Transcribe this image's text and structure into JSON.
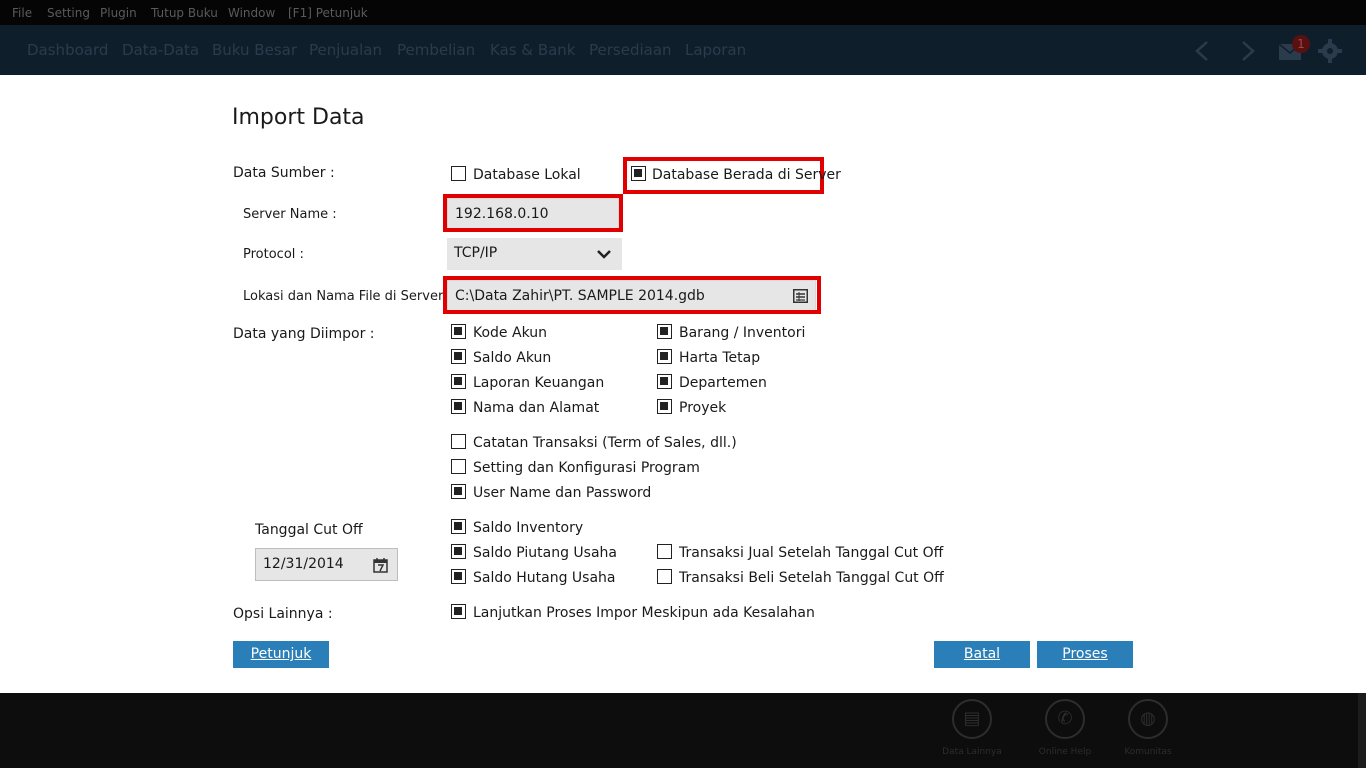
{
  "menubar": {
    "items": [
      "File",
      "Setting",
      "Plugin",
      "Tutup Buku",
      "Window",
      "[F1] Petunjuk"
    ]
  },
  "navbar": {
    "items": [
      "Dashboard",
      "Data-Data",
      "Buku Besar",
      "Penjualan",
      "Pembelian",
      "Kas & Bank",
      "Persediaan",
      "Laporan"
    ],
    "notification_count": "1"
  },
  "dialog": {
    "title": "Import Data",
    "data_sumber_label": "Data Sumber  :",
    "database_lokal": {
      "label": "Database Lokal",
      "checked": false
    },
    "database_server": {
      "label": "Database Berada di Server",
      "checked": true
    },
    "server_name_label": "Server Name :",
    "server_name_value": "192.168.0.10",
    "protocol_label": "Protocol :",
    "protocol_value": "TCP/IP",
    "lokasi_label": "Lokasi dan Nama File di Server :",
    "lokasi_value": "C:\\Data Zahir\\PT. SAMPLE 2014.gdb",
    "data_diimpor_label": "Data yang Diimpor :",
    "import_items": [
      {
        "label": "Kode Akun",
        "checked": true
      },
      {
        "label": "Saldo Akun",
        "checked": true
      },
      {
        "label": "Laporan Keuangan",
        "checked": true
      },
      {
        "label": "Nama dan Alamat",
        "checked": true
      },
      {
        "label": "Barang / Inventori",
        "checked": true
      },
      {
        "label": "Harta Tetap",
        "checked": true
      },
      {
        "label": "Departemen",
        "checked": true
      },
      {
        "label": "Proyek",
        "checked": true
      },
      {
        "label": "Catatan Transaksi (Term of Sales, dll.)",
        "checked": false
      },
      {
        "label": "Setting dan Konfigurasi Program",
        "checked": false
      },
      {
        "label": "User Name dan Password",
        "checked": true
      }
    ],
    "tanggal_label": "Tanggal Cut Off",
    "tanggal_value": "12/31/2014",
    "cutoff_items": [
      {
        "label": "Saldo Inventory",
        "checked": true
      },
      {
        "label": "Saldo Piutang Usaha",
        "checked": true
      },
      {
        "label": "Saldo Hutang Usaha",
        "checked": true
      },
      {
        "label": "Transaksi Jual Setelah Tanggal Cut Off",
        "checked": false
      },
      {
        "label": "Transaksi Beli Setelah Tanggal Cut Off",
        "checked": false
      }
    ],
    "opsi_label": "Opsi Lainnya :",
    "opsi_item": {
      "label": "Lanjutkan Proses Impor Meskipun ada Kesalahan",
      "checked": true
    },
    "buttons": {
      "petunjuk": "Petunjuk",
      "batal": "Batal",
      "proses": "Proses"
    }
  },
  "footer": {
    "items": [
      "Data Lainnya",
      "Online Help",
      "Komunitas"
    ]
  },
  "colors": {
    "highlight": "#e00000",
    "button": "#2a7fb8",
    "navbar": "#0f1e2b"
  }
}
